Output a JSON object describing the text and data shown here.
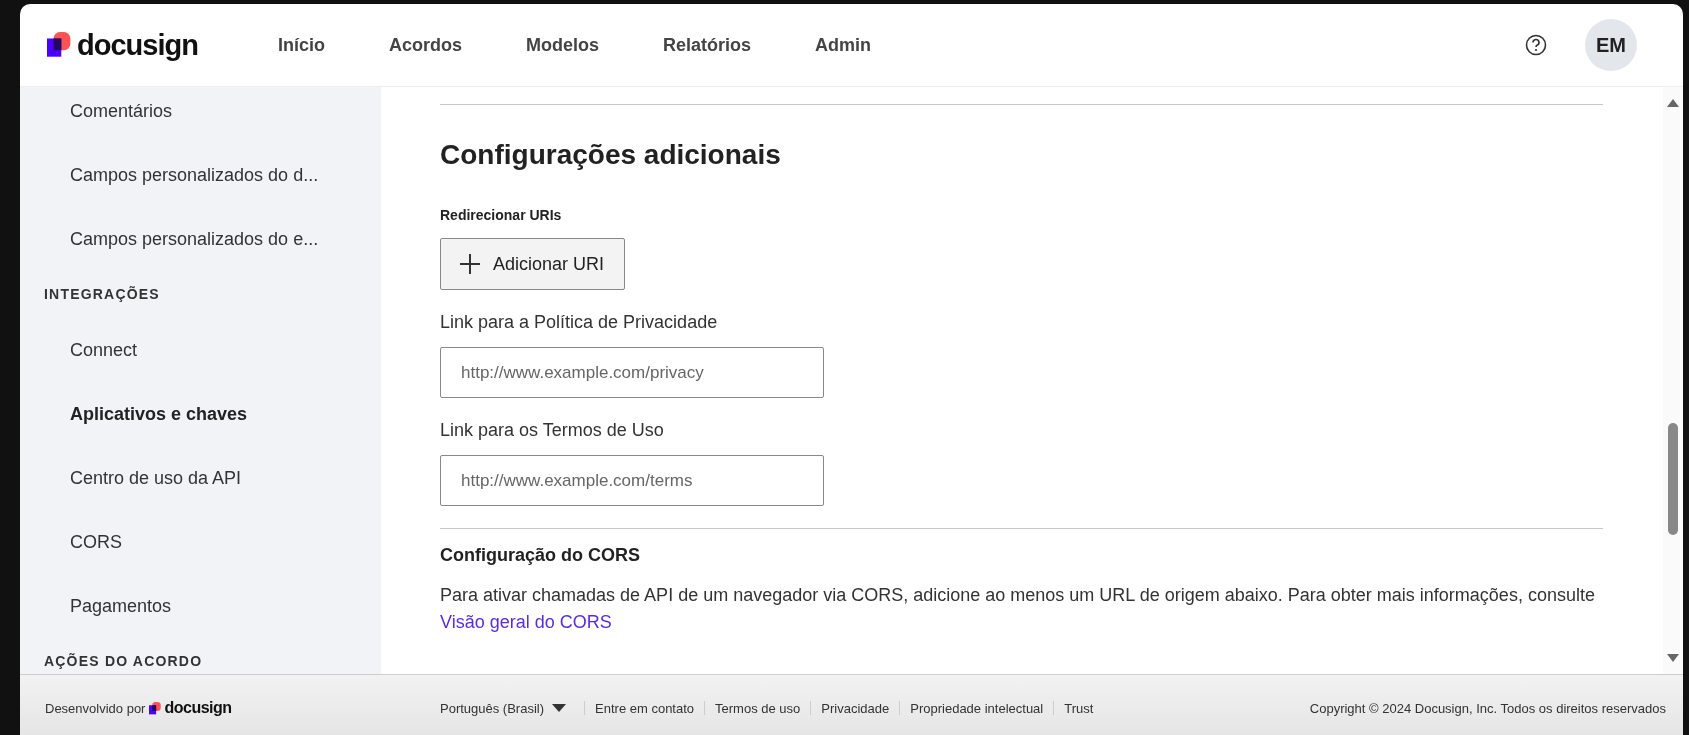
{
  "header": {
    "logo": "docusign",
    "nav": [
      {
        "label": "Início",
        "selected": false
      },
      {
        "label": "Acordos",
        "selected": false
      },
      {
        "label": "Modelos",
        "selected": false
      },
      {
        "label": "Relatórios",
        "selected": false
      },
      {
        "label": "Admin",
        "selected": false
      }
    ],
    "avatar": "EM"
  },
  "sidebar": {
    "items": [
      {
        "kind": "link",
        "label": "Comentários",
        "selected": false
      },
      {
        "kind": "link",
        "label": "Campos personalizados do d...",
        "selected": false
      },
      {
        "kind": "link",
        "label": "Campos personalizados do e...",
        "selected": false
      },
      {
        "kind": "section",
        "label": "INTEGRAÇÕES"
      },
      {
        "kind": "link",
        "label": "Connect",
        "selected": false
      },
      {
        "kind": "link",
        "label": "Aplicativos e chaves",
        "selected": true
      },
      {
        "kind": "link",
        "label": "Centro de uso da API",
        "selected": false
      },
      {
        "kind": "link",
        "label": "CORS",
        "selected": false
      },
      {
        "kind": "link",
        "label": "Pagamentos",
        "selected": false
      },
      {
        "kind": "section",
        "label": "AÇÕES DO ACORDO"
      }
    ]
  },
  "main": {
    "title": "Configurações adicionais",
    "redirect_label": "Redirecionar URIs",
    "add_button": "Adicionar URI",
    "fields": [
      {
        "label": "Link para a Política de Privacidade",
        "placeholder": "http://www.example.com/privacy"
      },
      {
        "label": "Link para os Termos de Uso",
        "placeholder": "http://www.example.com/terms"
      }
    ],
    "cors_title": "Configuração do CORS",
    "cors_text": "Para ativar chamadas de API de um navegador via CORS, adicione ao menos um URL de origem abaixo. Para obter mais informações, consulte",
    "cors_link": "Visão geral do CORS"
  },
  "footer": {
    "powered_by": "Desenvolvido por",
    "logo": "docusign",
    "language": "Português (Brasil)",
    "links": [
      "Entre em contato",
      "Termos de uso",
      "Privacidade",
      "Propriedade intelectual",
      "Trust"
    ],
    "copyright": "Copyright © 2024 Docusign, Inc. Todos os direitos reservados"
  }
}
